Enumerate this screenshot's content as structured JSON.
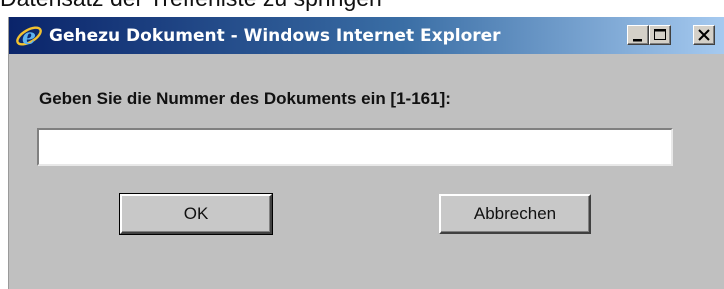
{
  "background_text": "Datensatz der Trefferliste zu springen",
  "window": {
    "title": "Gehezu Dokument - Windows Internet Explorer",
    "icon": "internet-explorer-icon",
    "controls": {
      "minimize": "minimize-icon",
      "maximize": "maximize-icon",
      "close": "close-icon"
    }
  },
  "dialog": {
    "prompt": "Geben Sie die Nummer des Dokuments ein [1-161]:",
    "input_value": "",
    "ok_label": "OK",
    "cancel_label": "Abbrechen"
  },
  "colors": {
    "titlebar_start": "#0a246a",
    "titlebar_end": "#a6caf0",
    "dialog_bg": "#c0c0c0"
  }
}
